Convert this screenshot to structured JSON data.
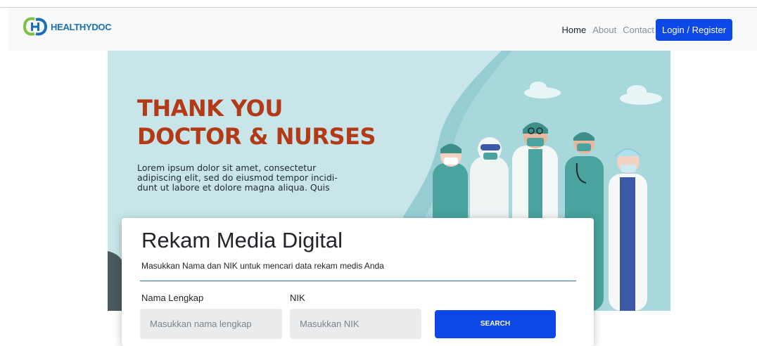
{
  "brand": {
    "name": "HEALTHYDOC",
    "logo_icon": "healthydoc-logo-icon"
  },
  "nav": {
    "links": [
      "Home",
      "About",
      "Contact"
    ],
    "login_label": "Login / Register"
  },
  "hero": {
    "title_line1": "THANK YOU",
    "title_line2": "DOCTOR & NURSES",
    "text_line1": "Lorem ipsum dolor sit amet, consectetur",
    "text_line2": "adipiscing elit, sed do eiusmod tempor incidi-",
    "text_line3": "dunt ut labore et dolore magna aliqua. Quis"
  },
  "search": {
    "title": "Rekam Media Digital",
    "subtitle": "Masukkan Nama dan NIK untuk mencari data rekam medis Anda",
    "name_label": "Nama Lengkap",
    "name_placeholder": "Masukkan nama lengkap",
    "nik_label": "NIK",
    "nik_placeholder": "Masukkan NIK",
    "button_label": "SEARCH"
  },
  "colors": {
    "primary": "#0d47e6",
    "hero_background": "#c8e6ea",
    "hero_title": "#b23a17",
    "logo_blue": "#1a6fb5",
    "logo_green": "#7cc242"
  }
}
